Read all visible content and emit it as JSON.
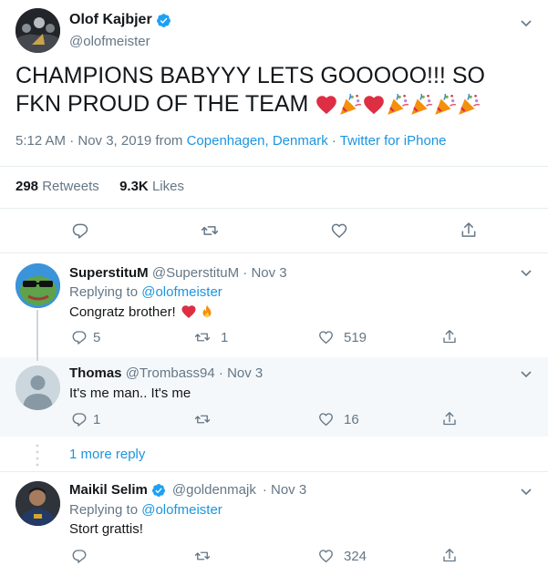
{
  "main_tweet": {
    "author_name": "Olof Kajbjer",
    "author_handle": "@olofmeister",
    "text": "CHAMPIONS BABYYY LETS GOOOOO!!! SO FKN PROUD OF THE TEAM",
    "time": "5:12 AM · Nov 3, 2019 from",
    "location": "Copenhagen, Denmark",
    "dot": "·",
    "source": "Twitter for iPhone",
    "retweets_count": "298",
    "retweets_label": "Retweets",
    "likes_count": "9.3K",
    "likes_label": "Likes"
  },
  "replies": [
    {
      "name": "SuperstituM",
      "handle": "@SuperstituM",
      "date": "· Nov 3",
      "replying_label": "Replying to",
      "replying_to": "@olofmeister",
      "text": "Congratz brother!",
      "replies": "5",
      "retweets": "1",
      "likes": "519"
    },
    {
      "name": "Thomas",
      "handle": "@Trombass94",
      "date": "· Nov 3",
      "text": "It's me man.. It's me",
      "replies": "1",
      "likes": "16"
    },
    {
      "name": "Maikil Selim",
      "handle": "@goldenmajk",
      "date": "· Nov 3",
      "replying_label": "Replying to",
      "replying_to": "@olofmeister",
      "text": "Stort grattis!",
      "likes": "324"
    }
  ],
  "more_replies": "1 more reply",
  "colors": {
    "accent": "#1b95e0",
    "verified": "#1da1f2",
    "muted": "#657786",
    "heart": "#e0245e",
    "highlight": "#f5f8fa"
  }
}
